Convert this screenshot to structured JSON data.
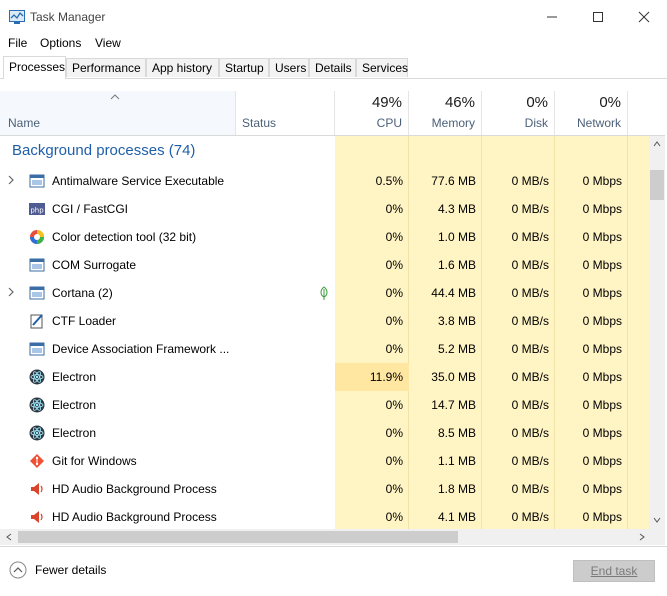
{
  "window": {
    "title": "Task Manager",
    "minimize_icon": "minimize-icon",
    "maximize_icon": "maximize-icon",
    "close_icon": "close-icon"
  },
  "menu": [
    "File",
    "Options",
    "View"
  ],
  "tabs": [
    "Processes",
    "Performance",
    "App history",
    "Startup",
    "Users",
    "Details",
    "Services"
  ],
  "active_tab": "Processes",
  "columns": {
    "name": "Name",
    "status": "Status",
    "cpu": {
      "pct": "49%",
      "label": "CPU"
    },
    "memory": {
      "pct": "46%",
      "label": "Memory"
    },
    "disk": {
      "pct": "0%",
      "label": "Disk"
    },
    "network": {
      "pct": "0%",
      "label": "Network"
    }
  },
  "group_title": "Background processes (74)",
  "rows": [
    {
      "name": "Antimalware Service Executable",
      "expandable": true,
      "icon": "window-icon",
      "cpu": "0.5%",
      "memory": "77.6 MB",
      "disk": "0 MB/s",
      "network": "0 Mbps"
    },
    {
      "name": "CGI / FastCGI",
      "expandable": false,
      "icon": "php-icon",
      "cpu": "0%",
      "memory": "4.3 MB",
      "disk": "0 MB/s",
      "network": "0 Mbps"
    },
    {
      "name": "Color detection tool (32 bit)",
      "expandable": false,
      "icon": "color-wheel-icon",
      "cpu": "0%",
      "memory": "1.0 MB",
      "disk": "0 MB/s",
      "network": "0 Mbps"
    },
    {
      "name": "COM Surrogate",
      "expandable": false,
      "icon": "window-icon",
      "cpu": "0%",
      "memory": "1.6 MB",
      "disk": "0 MB/s",
      "network": "0 Mbps"
    },
    {
      "name": "Cortana (2)",
      "expandable": true,
      "icon": "window-icon",
      "status_icon": "leaf-icon",
      "cpu": "0%",
      "memory": "44.4 MB",
      "disk": "0 MB/s",
      "network": "0 Mbps"
    },
    {
      "name": "CTF Loader",
      "expandable": false,
      "icon": "pen-icon",
      "cpu": "0%",
      "memory": "3.8 MB",
      "disk": "0 MB/s",
      "network": "0 Mbps"
    },
    {
      "name": "Device Association Framework ...",
      "expandable": false,
      "icon": "window-icon",
      "cpu": "0%",
      "memory": "5.2 MB",
      "disk": "0 MB/s",
      "network": "0 Mbps"
    },
    {
      "name": "Electron",
      "expandable": false,
      "icon": "electron-icon",
      "cpu": "11.9%",
      "memory": "35.0 MB",
      "disk": "0 MB/s",
      "network": "0 Mbps"
    },
    {
      "name": "Electron",
      "expandable": false,
      "icon": "electron-icon",
      "cpu": "0%",
      "memory": "14.7 MB",
      "disk": "0 MB/s",
      "network": "0 Mbps"
    },
    {
      "name": "Electron",
      "expandable": false,
      "icon": "electron-icon",
      "cpu": "0%",
      "memory": "8.5 MB",
      "disk": "0 MB/s",
      "network": "0 Mbps"
    },
    {
      "name": "Git for Windows",
      "expandable": false,
      "icon": "git-icon",
      "cpu": "0%",
      "memory": "1.1 MB",
      "disk": "0 MB/s",
      "network": "0 Mbps"
    },
    {
      "name": "HD Audio Background Process",
      "expandable": false,
      "icon": "speaker-icon",
      "cpu": "0%",
      "memory": "1.8 MB",
      "disk": "0 MB/s",
      "network": "0 Mbps"
    },
    {
      "name": "HD Audio Background Process",
      "expandable": false,
      "icon": "speaker-icon",
      "cpu": "0%",
      "memory": "4.1 MB",
      "disk": "0 MB/s",
      "network": "0 Mbps"
    }
  ],
  "footer": {
    "fewer_details": "Fewer details",
    "end_task": "End task"
  },
  "colors": {
    "accent_blue": "#1f5fa9",
    "heat_low": "#fff4c4",
    "heat_mid": "#ffe6a1",
    "header_label": "#4c607a"
  }
}
